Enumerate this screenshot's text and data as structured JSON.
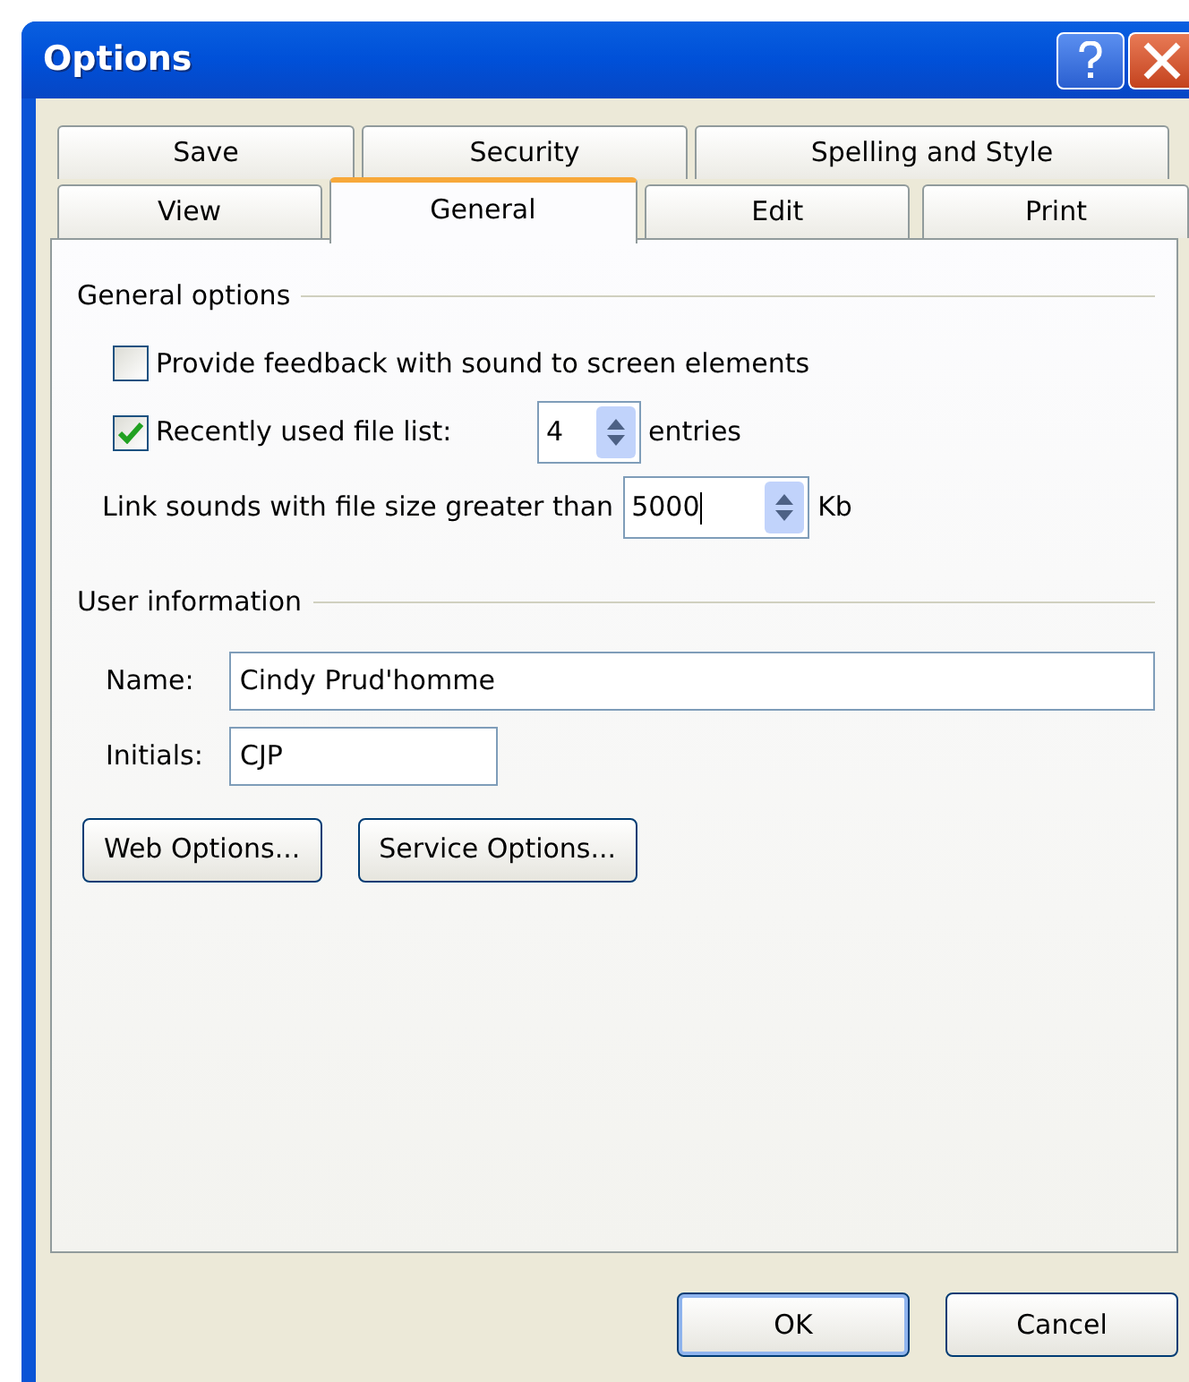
{
  "window": {
    "title": "Options"
  },
  "tab_rows": [
    {
      "tabs": [
        {
          "label": "Save",
          "selected": false
        },
        {
          "label": "Security",
          "selected": false
        },
        {
          "label": "Spelling and Style",
          "selected": false
        }
      ]
    },
    {
      "tabs": [
        {
          "label": "View",
          "selected": false
        },
        {
          "label": "General",
          "selected": true
        },
        {
          "label": "Edit",
          "selected": false
        },
        {
          "label": "Print",
          "selected": false
        }
      ]
    }
  ],
  "general_options": {
    "heading": "General options",
    "feedback_sound": {
      "label": "Provide feedback with sound to screen elements",
      "checked": false
    },
    "recent_files": {
      "label": "Recently used file list:",
      "checked": true,
      "value": "4",
      "unit": "entries"
    },
    "link_sounds": {
      "label": "Link sounds with file size greater than",
      "value": "5000",
      "unit": "Kb"
    }
  },
  "user_information": {
    "heading": "User information",
    "name": {
      "label": "Name:",
      "value": "Cindy Prud'homme"
    },
    "initials": {
      "label": "Initials:",
      "value": "CJP"
    }
  },
  "panel_buttons": [
    "Web Options...",
    "Service Options..."
  ],
  "dialog_buttons": [
    {
      "label": "OK",
      "default": true
    },
    {
      "label": "Cancel",
      "default": false
    }
  ]
}
